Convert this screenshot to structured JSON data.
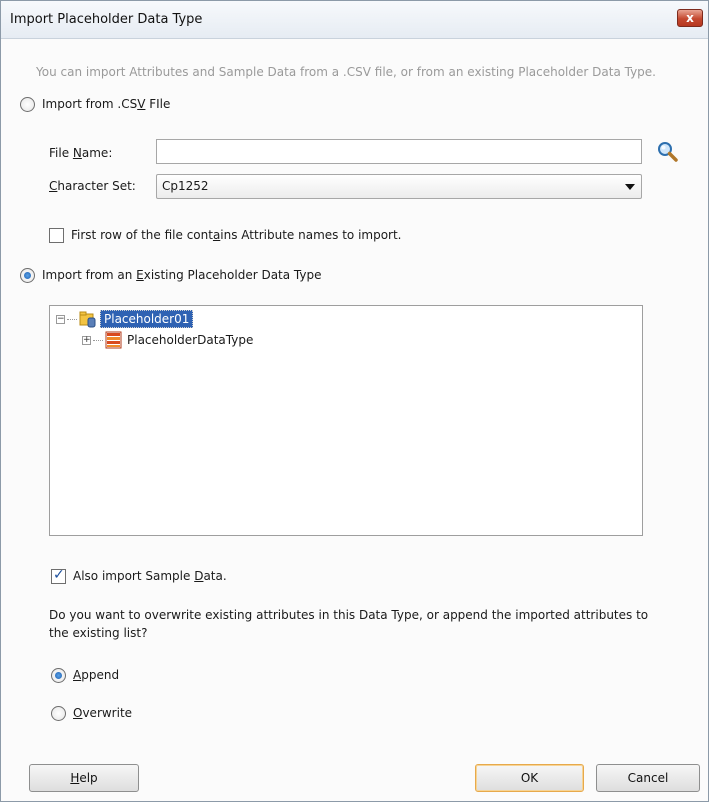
{
  "dialog": {
    "title": "Import Placeholder Data Type",
    "close_label": "x",
    "hint": "You can import Attributes and Sample Data from a .CSV file, or from an existing Placeholder Data Type."
  },
  "csv": {
    "radio_label_pre": "Import from .CS",
    "radio_label_mnemonic": "V",
    "radio_label_post": " FIle",
    "file_name_label_pre": "File ",
    "file_name_label_mnemonic": "N",
    "file_name_label_post": "ame:",
    "file_name_value": "",
    "charset_label_mnemonic": "C",
    "charset_label_post": "haracter Set:",
    "charset_value": "Cp1252",
    "first_row_label_pre": "First row of the file cont",
    "first_row_label_mnemonic": "a",
    "first_row_label_post": "ins Attribute names to import."
  },
  "existing": {
    "radio_label_pre": "Import from an ",
    "radio_label_mnemonic": "E",
    "radio_label_post": "xisting Placeholder Data Type",
    "tree": [
      {
        "label": "Placeholder01",
        "expanded": true,
        "selected": true
      },
      {
        "label": "PlaceholderDataType",
        "expanded": false,
        "selected": false
      }
    ]
  },
  "sample": {
    "checkbox_label_pre": "Also import Sample ",
    "checkbox_label_mnemonic": "D",
    "checkbox_label_post": "ata.",
    "checked": true
  },
  "question": {
    "line1": "Do you want to overwrite existing attributes in this Data Type, or append the imported attributes to",
    "line2": "the existing list?"
  },
  "mode": {
    "append_mnemonic": "A",
    "append_post": "ppend",
    "overwrite_mnemonic": "O",
    "overwrite_post": "verwrite",
    "selected": "Append"
  },
  "buttons": {
    "help_mnemonic": "H",
    "help_post": "elp",
    "ok": "OK",
    "cancel": "Cancel"
  },
  "colors": {
    "selection": "#2f62b3",
    "default_button_border": "#e7a94b"
  }
}
